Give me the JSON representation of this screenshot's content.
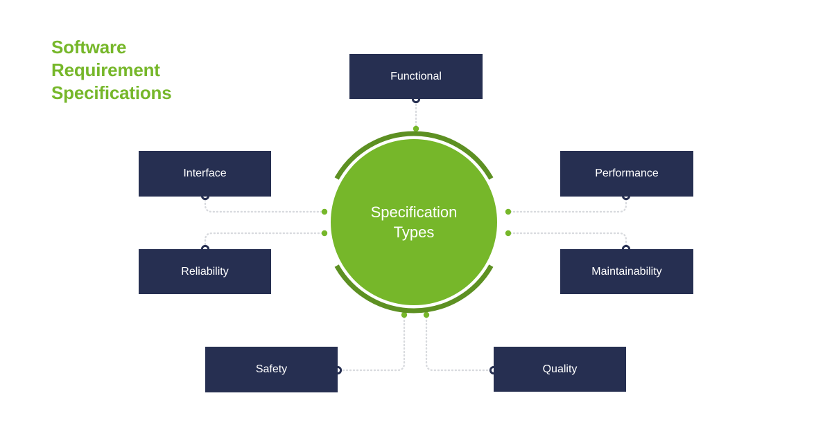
{
  "title": {
    "text": "Software\nRequirement\nSpecifications",
    "color": "#76b72a"
  },
  "hub": {
    "label": "Specification\nTypes",
    "fill": "#76b72a",
    "text_color": "#ffffff",
    "arc_color": "#5d9022"
  },
  "theme": {
    "node_fill": "#262f51",
    "node_text": "#ffffff",
    "connector_line": "#d8dade",
    "connector_dot_green": "#76b72a",
    "connector_dot_ring": "#262f51",
    "background": "#ffffff"
  },
  "nodes": [
    {
      "id": "functional",
      "label": "Functional"
    },
    {
      "id": "interface",
      "label": "Interface"
    },
    {
      "id": "performance",
      "label": "Performance"
    },
    {
      "id": "reliability",
      "label": "Reliability"
    },
    {
      "id": "maintainability",
      "label": "Maintainability"
    },
    {
      "id": "safety",
      "label": "Safety"
    },
    {
      "id": "quality",
      "label": "Quality"
    }
  ]
}
